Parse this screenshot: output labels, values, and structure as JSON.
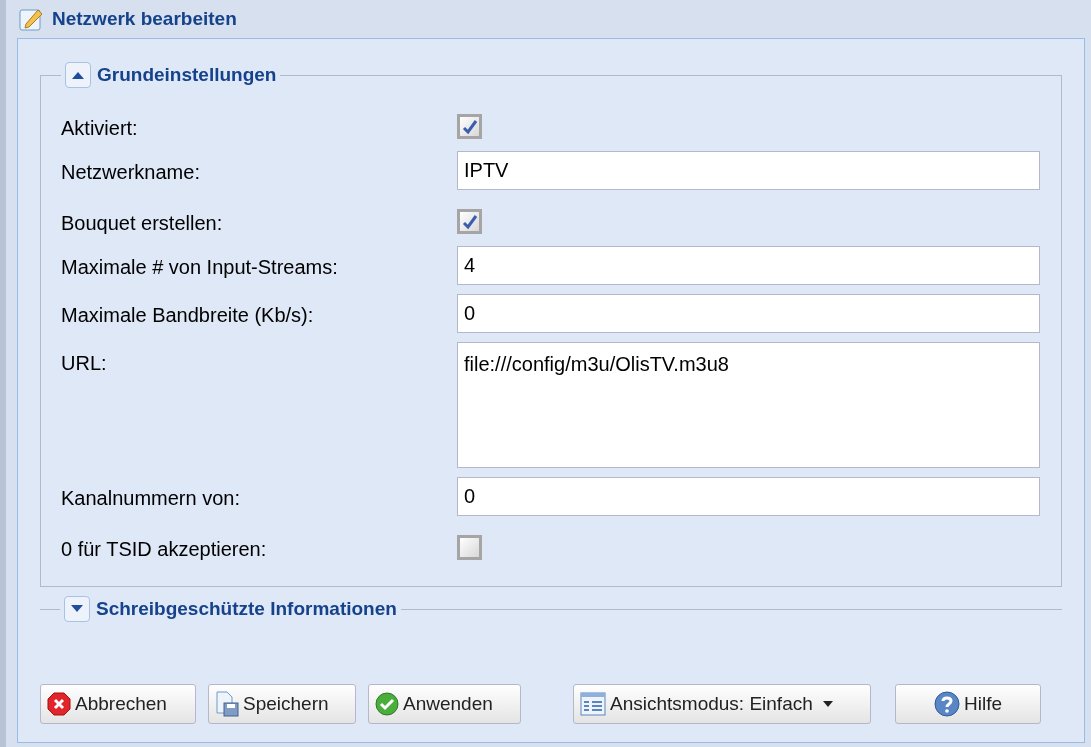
{
  "window": {
    "title": "Netzwerk bearbeiten"
  },
  "sections": [
    {
      "title": "Grundeinstellungen",
      "expanded": true,
      "fields": [
        {
          "kind": "checkbox",
          "label": "Aktiviert:",
          "checked": true
        },
        {
          "kind": "text",
          "label": "Netzwerkname:",
          "value": "IPTV"
        },
        {
          "kind": "checkbox",
          "label": "Bouquet erstellen:",
          "checked": true
        },
        {
          "kind": "text",
          "label": "Maximale # von Input-Streams:",
          "value": "4"
        },
        {
          "kind": "text",
          "label": "Maximale Bandbreite (Kb/s):",
          "value": "0"
        },
        {
          "kind": "textarea",
          "label": "URL:",
          "value": "file:///config/m3u/OlisTV.m3u8"
        },
        {
          "kind": "text",
          "label": "Kanalnummern von:",
          "value": "0"
        },
        {
          "kind": "checkbox",
          "label": "0 für TSID akzeptieren:",
          "checked": false
        }
      ]
    },
    {
      "title": "Schreibgeschützte Informationen",
      "expanded": false
    }
  ],
  "buttons": [
    {
      "kind": "cancel",
      "label": "Abbrechen"
    },
    {
      "kind": "save",
      "label": "Speichern"
    },
    {
      "kind": "apply",
      "label": "Anwenden"
    },
    {
      "kind": "view",
      "label": "Ansichtsmodus: Einfach"
    },
    {
      "kind": "help",
      "label": "Hilfe"
    }
  ]
}
